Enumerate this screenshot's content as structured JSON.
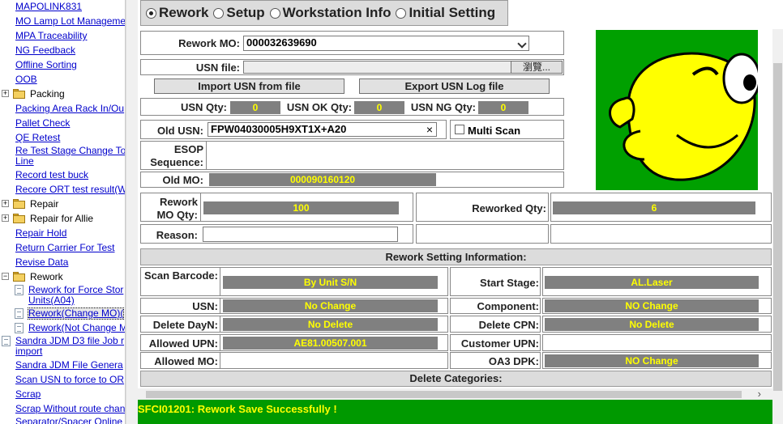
{
  "sidebar": {
    "items": [
      {
        "label": "MAPOLINK831"
      },
      {
        "label": "MO Lamp Lot Manageme"
      },
      {
        "label": "MPA Traceability"
      },
      {
        "label": "NG Feedback"
      },
      {
        "label": "Offline Sorting"
      },
      {
        "label": "OOB"
      },
      {
        "label": "Packing"
      },
      {
        "label": "Packing Area Rack In/Ou"
      },
      {
        "label": "Pallet Check"
      },
      {
        "label": "QE Retest"
      },
      {
        "label": "Re Test Stage Change To Line"
      },
      {
        "label": "Record test buck"
      },
      {
        "label": "Recore ORT test result(W"
      },
      {
        "label": "Repair"
      },
      {
        "label": "Repair for Allie"
      },
      {
        "label": "Repair Hold"
      },
      {
        "label": "Return Carrier For Test"
      },
      {
        "label": "Revise Data"
      },
      {
        "label": "Rework"
      },
      {
        "label": "Rework for Force Stor Units(A04)"
      },
      {
        "label": "Rework(Change MO)("
      },
      {
        "label": "Rework(Not Change M"
      },
      {
        "label": "Sandra JDM D3 file Job r import"
      },
      {
        "label": "Sandra JDM File Genera"
      },
      {
        "label": "Scan USN to force to OR"
      },
      {
        "label": "Scrap"
      },
      {
        "label": "Scrap Without route chan"
      },
      {
        "label": "Separator/Spacer Online"
      }
    ]
  },
  "modes": {
    "rework": "Rework",
    "setup": "Setup",
    "workstation": "Workstation Info",
    "initial": "Initial Setting"
  },
  "form": {
    "rework_mo_label": "Rework MO:",
    "rework_mo_value": "000032639690",
    "usn_file_label": "USN file:",
    "browse_label": "瀏覽...",
    "import_label": "Import USN from file",
    "export_label": "Export USN Log file",
    "usn_qty_label": "USN Qty:",
    "usn_qty": "0",
    "usn_ok_label": "USN OK Qty:",
    "usn_ok": "0",
    "usn_ng_label": "USN NG Qty:",
    "usn_ng": "0",
    "old_usn_label": "Old USN:",
    "old_usn_value": "FPW04030005H9XT1X+A20",
    "clear_glyph": "×",
    "multi_scan_label": "Multi Scan",
    "esop_label": "ESOP Sequence:",
    "old_mo_label": "Old MO:",
    "old_mo_value": "000090160120",
    "rework_mo_qty_label": "Rework MO Qty:",
    "rework_mo_qty": "100",
    "reworked_qty_label": "Reworked Qty:",
    "reworked_qty": "6",
    "reason_label": "Reason:"
  },
  "settings": {
    "heading": "Rework Setting Information:",
    "scan_barcode_label": "Scan Barcode:",
    "scan_barcode": "By Unit S/N",
    "start_stage_label": "Start Stage:",
    "start_stage": "AL.Laser",
    "usn_label": "USN:",
    "usn": "No Change",
    "component_label": "Component:",
    "component": "NO Change",
    "delete_dayn_label": "Delete DayN:",
    "delete_dayn": "No Delete",
    "delete_cpn_label": "Delete CPN:",
    "delete_cpn": "No Delete",
    "allowed_upn_label": "Allowed UPN:",
    "allowed_upn": "AE81.00507.001",
    "customer_upn_label": "Customer UPN:",
    "allowed_mo_label": "Allowed MO:",
    "oa3_dpk_label": "OA3 DPK:",
    "oa3_dpk": "NO Change",
    "delete_categories": "Delete Categories:"
  },
  "status": {
    "message": "SFCI01201: Rework Save Successfully !"
  },
  "colors": {
    "status_bg": "#009900",
    "value_bg": "#808080",
    "value_text": "#ffff00"
  }
}
